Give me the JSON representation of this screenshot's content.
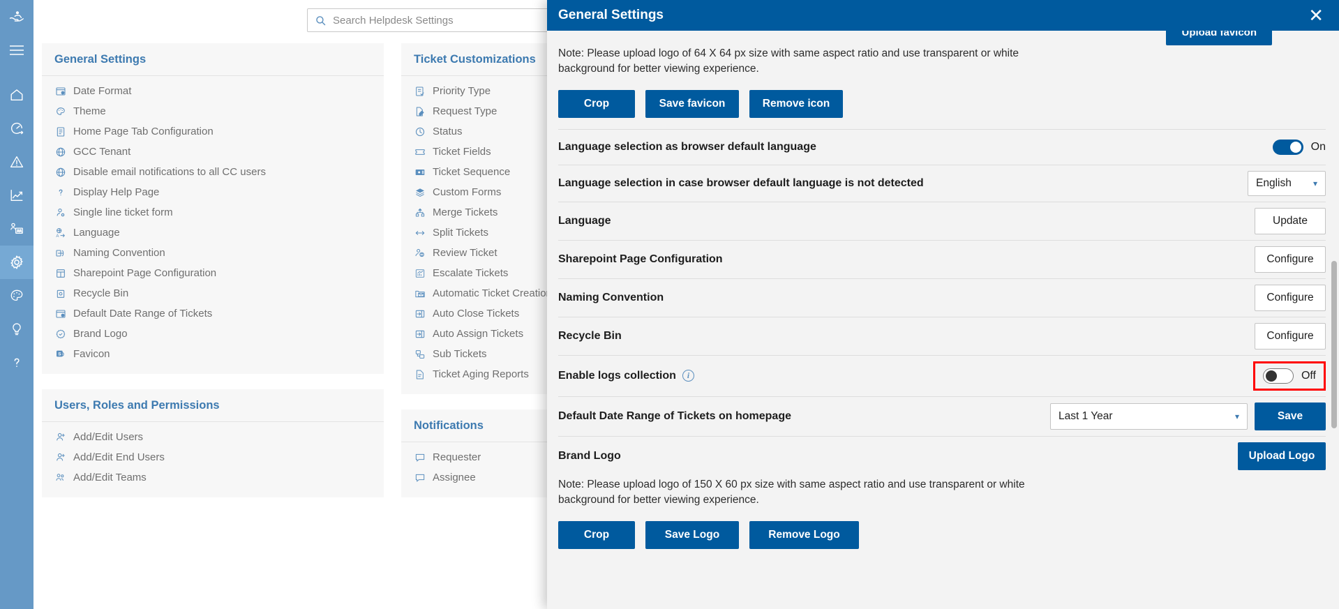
{
  "rail": {
    "items": [
      {
        "name": "helping-hand-logo-icon",
        "label": "Helpdesk Logo"
      },
      {
        "name": "hamburger-menu-icon",
        "label": "Menu"
      },
      {
        "name": "home-icon",
        "label": "Home"
      },
      {
        "name": "dashboard-speedometer-icon",
        "label": "Dashboard"
      },
      {
        "name": "alert-warning-icon",
        "label": "Alerts"
      },
      {
        "name": "analytics-chart-icon",
        "label": "Analytics"
      },
      {
        "name": "teams-presentation-icon",
        "label": "Teams"
      },
      {
        "name": "settings-gear-icon",
        "label": "Settings"
      },
      {
        "name": "palette-theme-icon",
        "label": "Theme"
      },
      {
        "name": "lightbulb-idea-icon",
        "label": "Ideas"
      },
      {
        "name": "help-question-icon",
        "label": "Help"
      }
    ]
  },
  "search": {
    "placeholder": "Search Helpdesk Settings",
    "icon": "search-icon"
  },
  "columns": [
    {
      "cards": [
        {
          "title": "General Settings",
          "items": [
            {
              "icon": "date-format-icon",
              "label": "Date Format"
            },
            {
              "icon": "theme-palette-icon",
              "label": "Theme"
            },
            {
              "icon": "document-icon",
              "label": "Home Page Tab Configuration"
            },
            {
              "icon": "globe-icon",
              "label": "GCC Tenant"
            },
            {
              "icon": "globe-icon",
              "label": "Disable email notifications to all CC users"
            },
            {
              "icon": "question-mark-icon",
              "label": "Display Help Page"
            },
            {
              "icon": "user-remove-icon",
              "label": "Single line ticket form"
            },
            {
              "icon": "translate-language-icon",
              "label": "Language"
            },
            {
              "icon": "naming-convention-icon",
              "label": "Naming Convention"
            },
            {
              "icon": "sharepoint-page-icon",
              "label": "Sharepoint Page Configuration"
            },
            {
              "icon": "recycle-bin-icon",
              "label": "Recycle Bin"
            },
            {
              "icon": "date-range-icon",
              "label": "Default Date Range of Tickets"
            },
            {
              "icon": "badge-check-icon",
              "label": "Brand Logo"
            },
            {
              "icon": "favicon-icon",
              "label": "Favicon"
            }
          ]
        },
        {
          "title": "Users, Roles and Permissions",
          "items": [
            {
              "icon": "add-user-icon",
              "label": "Add/Edit Users"
            },
            {
              "icon": "add-end-user-icon",
              "label": "Add/Edit End Users"
            },
            {
              "icon": "add-team-icon",
              "label": "Add/Edit Teams"
            }
          ]
        }
      ]
    },
    {
      "cards": [
        {
          "title": "Ticket Customizations",
          "items": [
            {
              "icon": "priority-list-icon",
              "label": "Priority Type"
            },
            {
              "icon": "request-edit-icon",
              "label": "Request Type"
            },
            {
              "icon": "status-clock-icon",
              "label": "Status"
            },
            {
              "icon": "ticket-fields-icon",
              "label": "Ticket Fields"
            },
            {
              "icon": "ticket-sequence-icon",
              "label": "Ticket Sequence"
            },
            {
              "icon": "custom-forms-layers-icon",
              "label": "Custom Forms"
            },
            {
              "icon": "merge-tickets-icon",
              "label": "Merge Tickets"
            },
            {
              "icon": "split-tickets-icon",
              "label": "Split Tickets"
            },
            {
              "icon": "review-ticket-users-icon",
              "label": "Review Ticket"
            },
            {
              "icon": "escalate-chart-icon",
              "label": "Escalate Tickets"
            },
            {
              "icon": "automatic-ticket-mail-icon",
              "label": "Automatic Ticket Creation"
            },
            {
              "icon": "auto-close-icon",
              "label": "Auto Close Tickets"
            },
            {
              "icon": "auto-assign-icon",
              "label": "Auto Assign Tickets"
            },
            {
              "icon": "sub-tickets-icon",
              "label": "Sub Tickets"
            },
            {
              "icon": "ticket-aging-report-icon",
              "label": "Ticket Aging Reports"
            }
          ]
        },
        {
          "title": "Notifications",
          "items": [
            {
              "icon": "requester-comment-icon",
              "label": "Requester"
            },
            {
              "icon": "assignee-comment-icon",
              "label": "Assignee"
            }
          ]
        }
      ]
    }
  ],
  "modal": {
    "title": "General Settings",
    "close_icon": "close-icon",
    "cut_off_button": "Upload favicon",
    "favicon_note": "Note: Please upload logo of 64 X 64 px size with same aspect ratio and use transparent or white background for better viewing experience.",
    "favicon_buttons": [
      "Crop",
      "Save favicon",
      "Remove icon"
    ],
    "rows": [
      {
        "label": "Language selection as browser default language",
        "control": "toggle",
        "toggle_state": "On",
        "highlighted": false
      },
      {
        "label": "Language selection in case browser default language is not detected",
        "control": "select",
        "value": "English"
      },
      {
        "label": "Language",
        "control": "button",
        "button_label": "Update"
      },
      {
        "label": "Sharepoint Page Configuration",
        "control": "button",
        "button_label": "Configure"
      },
      {
        "label": "Naming Convention",
        "control": "button",
        "button_label": "Configure"
      },
      {
        "label": "Recycle Bin",
        "control": "button",
        "button_label": "Configure"
      },
      {
        "label": "Enable logs collection",
        "control": "toggle",
        "toggle_state": "Off",
        "highlighted": true,
        "info_icon": "info-icon"
      }
    ],
    "date_range_row": {
      "label": "Default Date Range of Tickets on homepage",
      "value": "Last 1 Year",
      "save_label": "Save"
    },
    "brand_logo": {
      "label": "Brand Logo",
      "upload_label": "Upload Logo",
      "note": "Note: Please upload logo of 150 X 60 px size with same aspect ratio and use transparent or white background for better viewing experience.",
      "buttons": [
        "Crop",
        "Save Logo",
        "Remove Logo"
      ]
    }
  },
  "colors": {
    "rail": "#6699c6",
    "rail_active": "#76a9d4",
    "accent": "#005a9e",
    "link": "#3d7ab0",
    "highlight": "#ff0000"
  }
}
